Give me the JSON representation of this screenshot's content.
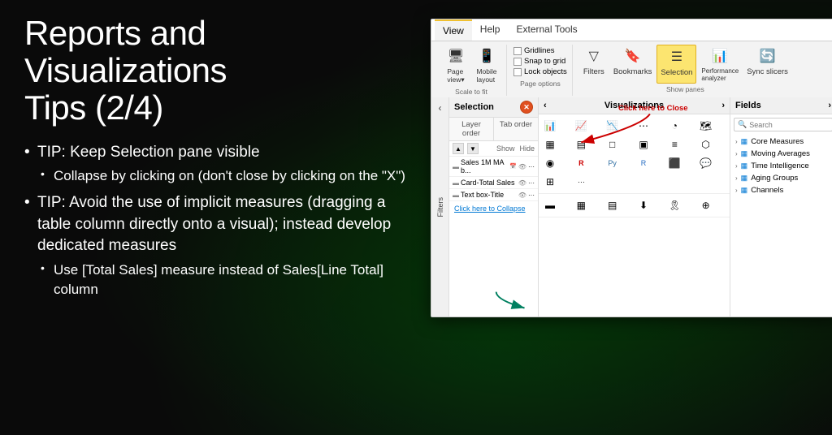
{
  "page": {
    "title": "Reports and Visualizations Tips (2/4)",
    "background_color": "#0a0a0a"
  },
  "left_panel": {
    "title_line1": "Reports and Visualizations",
    "title_line2": "Tips (2/4)",
    "bullets": [
      {
        "text": "TIP: Keep Selection pane visible",
        "sub_bullets": [
          "Collapse by clicking on (don't close by clicking on the \"X\")"
        ]
      },
      {
        "text": "TIP: Avoid the use of implicit measures (dragging a table column directly onto a visual); instead develop dedicated measures",
        "sub_bullets": [
          "Use [Total Sales] measure instead of Sales[Line Total] column"
        ]
      }
    ]
  },
  "ribbon": {
    "tabs": [
      "View",
      "Help",
      "External Tools"
    ],
    "active_tab": "View",
    "groups": {
      "scale_to_fit": {
        "label": "Scale to fit",
        "buttons": [
          {
            "label": "Page view▾",
            "icon": "🖥"
          },
          {
            "label": "Mobile layout",
            "icon": "📱"
          }
        ]
      },
      "page_options": {
        "label": "Page options",
        "checkboxes": [
          "Gridlines",
          "Snap to grid",
          "Lock objects"
        ]
      },
      "show_panes": {
        "label": "Show panes",
        "buttons": [
          {
            "label": "Filters",
            "icon": "▽"
          },
          {
            "label": "Bookmarks",
            "icon": "🔖"
          },
          {
            "label": "Selection",
            "highlighted": true,
            "icon": "☰"
          },
          {
            "label": "Performance analyzer",
            "icon": "📊"
          },
          {
            "label": "Sync slicers",
            "icon": "🔄"
          }
        ]
      }
    }
  },
  "selection_pane": {
    "title": "Selection",
    "tabs": [
      "Layer order",
      "Tab order"
    ],
    "items": [
      {
        "name": "Sales 1M MA b...",
        "has_date": true
      },
      {
        "name": "Card-Total Sales"
      },
      {
        "name": "Text box-Title"
      }
    ],
    "collapse_link": "Click here to Collapse",
    "show_label": "Show",
    "hide_label": "Hide"
  },
  "visualizations_pane": {
    "title": "Visualizations"
  },
  "fields_pane": {
    "title": "Fields",
    "search_placeholder": "Search",
    "groups": [
      {
        "name": "Core Measures",
        "icon": "table"
      },
      {
        "name": "Moving Averages",
        "icon": "table"
      },
      {
        "name": "Time Intelligence",
        "icon": "table"
      },
      {
        "name": "Aging Groups",
        "icon": "table"
      },
      {
        "name": "Channels",
        "icon": "table"
      }
    ]
  },
  "annotations": {
    "click_here_close": "Click here to Close",
    "click_here_collapse": "Click here to Collapse"
  },
  "icons": {
    "search": "🔍",
    "close": "✕",
    "expand_right": "›",
    "collapse_left": "‹",
    "chevron_down": "▾",
    "eye": "👁",
    "table": "▦"
  }
}
